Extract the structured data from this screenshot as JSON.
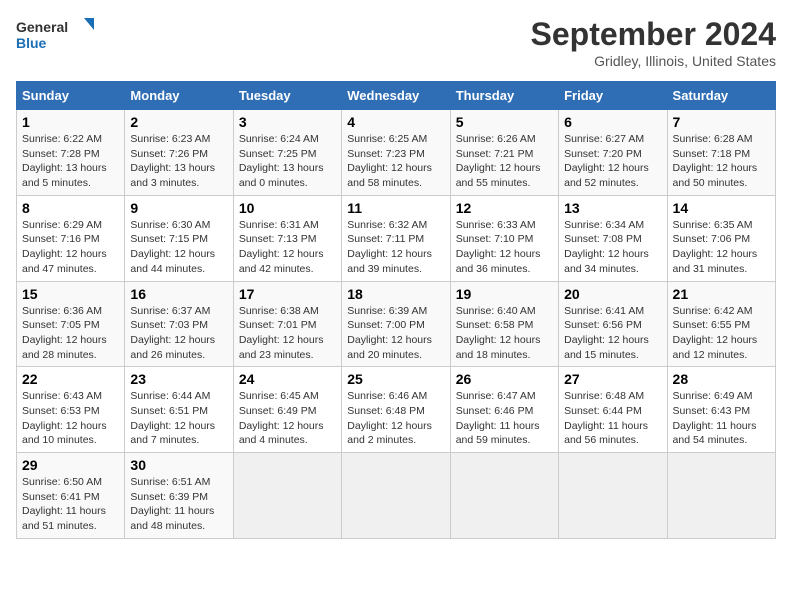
{
  "logo": {
    "line1": "General",
    "line2": "Blue"
  },
  "title": "September 2024",
  "subtitle": "Gridley, Illinois, United States",
  "weekdays": [
    "Sunday",
    "Monday",
    "Tuesday",
    "Wednesday",
    "Thursday",
    "Friday",
    "Saturday"
  ],
  "weeks": [
    [
      {
        "day": "1",
        "sunrise": "6:22 AM",
        "sunset": "7:28 PM",
        "daylight": "13 hours and 5 minutes."
      },
      {
        "day": "2",
        "sunrise": "6:23 AM",
        "sunset": "7:26 PM",
        "daylight": "13 hours and 3 minutes."
      },
      {
        "day": "3",
        "sunrise": "6:24 AM",
        "sunset": "7:25 PM",
        "daylight": "13 hours and 0 minutes."
      },
      {
        "day": "4",
        "sunrise": "6:25 AM",
        "sunset": "7:23 PM",
        "daylight": "12 hours and 58 minutes."
      },
      {
        "day": "5",
        "sunrise": "6:26 AM",
        "sunset": "7:21 PM",
        "daylight": "12 hours and 55 minutes."
      },
      {
        "day": "6",
        "sunrise": "6:27 AM",
        "sunset": "7:20 PM",
        "daylight": "12 hours and 52 minutes."
      },
      {
        "day": "7",
        "sunrise": "6:28 AM",
        "sunset": "7:18 PM",
        "daylight": "12 hours and 50 minutes."
      }
    ],
    [
      {
        "day": "8",
        "sunrise": "6:29 AM",
        "sunset": "7:16 PM",
        "daylight": "12 hours and 47 minutes."
      },
      {
        "day": "9",
        "sunrise": "6:30 AM",
        "sunset": "7:15 PM",
        "daylight": "12 hours and 44 minutes."
      },
      {
        "day": "10",
        "sunrise": "6:31 AM",
        "sunset": "7:13 PM",
        "daylight": "12 hours and 42 minutes."
      },
      {
        "day": "11",
        "sunrise": "6:32 AM",
        "sunset": "7:11 PM",
        "daylight": "12 hours and 39 minutes."
      },
      {
        "day": "12",
        "sunrise": "6:33 AM",
        "sunset": "7:10 PM",
        "daylight": "12 hours and 36 minutes."
      },
      {
        "day": "13",
        "sunrise": "6:34 AM",
        "sunset": "7:08 PM",
        "daylight": "12 hours and 34 minutes."
      },
      {
        "day": "14",
        "sunrise": "6:35 AM",
        "sunset": "7:06 PM",
        "daylight": "12 hours and 31 minutes."
      }
    ],
    [
      {
        "day": "15",
        "sunrise": "6:36 AM",
        "sunset": "7:05 PM",
        "daylight": "12 hours and 28 minutes."
      },
      {
        "day": "16",
        "sunrise": "6:37 AM",
        "sunset": "7:03 PM",
        "daylight": "12 hours and 26 minutes."
      },
      {
        "day": "17",
        "sunrise": "6:38 AM",
        "sunset": "7:01 PM",
        "daylight": "12 hours and 23 minutes."
      },
      {
        "day": "18",
        "sunrise": "6:39 AM",
        "sunset": "7:00 PM",
        "daylight": "12 hours and 20 minutes."
      },
      {
        "day": "19",
        "sunrise": "6:40 AM",
        "sunset": "6:58 PM",
        "daylight": "12 hours and 18 minutes."
      },
      {
        "day": "20",
        "sunrise": "6:41 AM",
        "sunset": "6:56 PM",
        "daylight": "12 hours and 15 minutes."
      },
      {
        "day": "21",
        "sunrise": "6:42 AM",
        "sunset": "6:55 PM",
        "daylight": "12 hours and 12 minutes."
      }
    ],
    [
      {
        "day": "22",
        "sunrise": "6:43 AM",
        "sunset": "6:53 PM",
        "daylight": "12 hours and 10 minutes."
      },
      {
        "day": "23",
        "sunrise": "6:44 AM",
        "sunset": "6:51 PM",
        "daylight": "12 hours and 7 minutes."
      },
      {
        "day": "24",
        "sunrise": "6:45 AM",
        "sunset": "6:49 PM",
        "daylight": "12 hours and 4 minutes."
      },
      {
        "day": "25",
        "sunrise": "6:46 AM",
        "sunset": "6:48 PM",
        "daylight": "12 hours and 2 minutes."
      },
      {
        "day": "26",
        "sunrise": "6:47 AM",
        "sunset": "6:46 PM",
        "daylight": "11 hours and 59 minutes."
      },
      {
        "day": "27",
        "sunrise": "6:48 AM",
        "sunset": "6:44 PM",
        "daylight": "11 hours and 56 minutes."
      },
      {
        "day": "28",
        "sunrise": "6:49 AM",
        "sunset": "6:43 PM",
        "daylight": "11 hours and 54 minutes."
      }
    ],
    [
      {
        "day": "29",
        "sunrise": "6:50 AM",
        "sunset": "6:41 PM",
        "daylight": "11 hours and 51 minutes."
      },
      {
        "day": "30",
        "sunrise": "6:51 AM",
        "sunset": "6:39 PM",
        "daylight": "11 hours and 48 minutes."
      },
      null,
      null,
      null,
      null,
      null
    ]
  ],
  "labels": {
    "sunrise": "Sunrise:",
    "sunset": "Sunset:",
    "daylight": "Daylight:"
  }
}
